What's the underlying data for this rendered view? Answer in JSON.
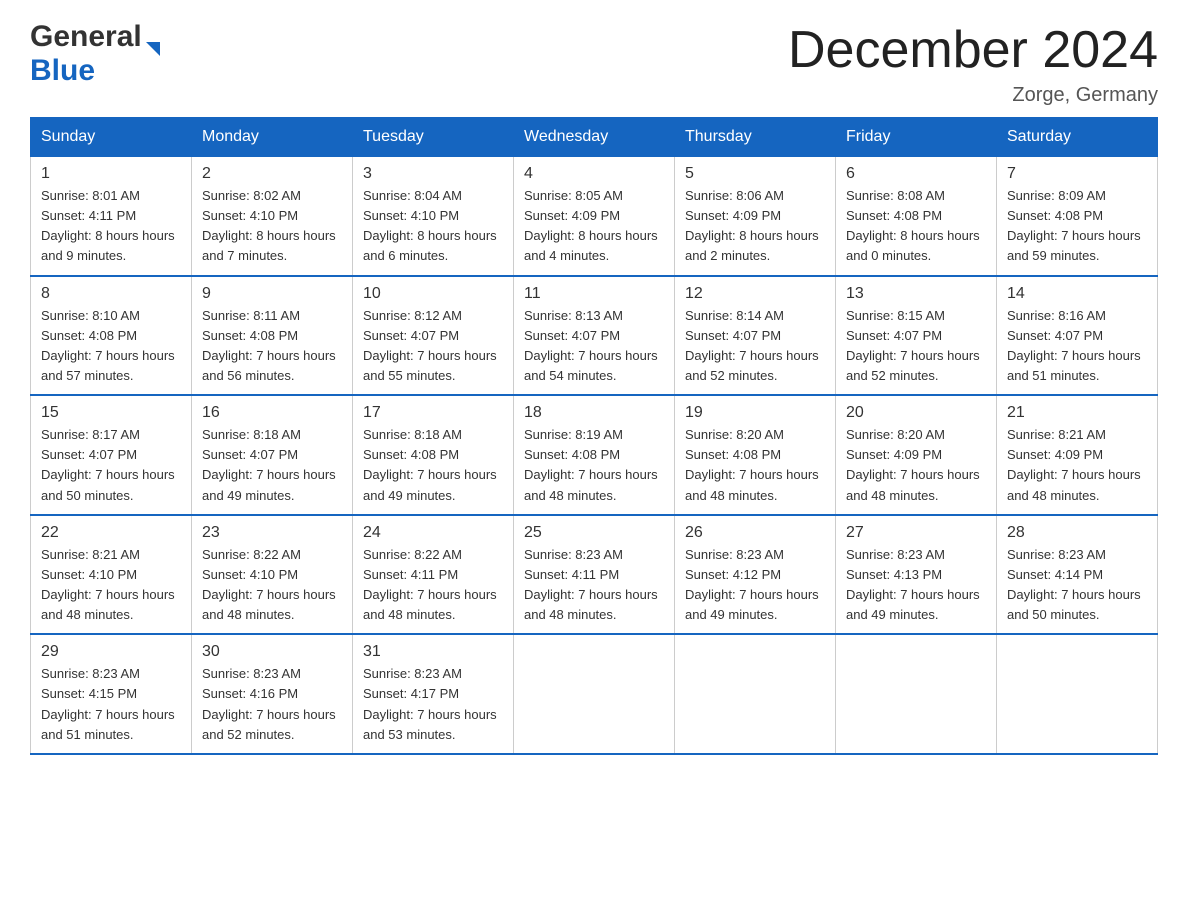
{
  "header": {
    "title": "December 2024",
    "subtitle": "Zorge, Germany",
    "logo_general": "General",
    "logo_blue": "Blue"
  },
  "weekdays": [
    "Sunday",
    "Monday",
    "Tuesday",
    "Wednesday",
    "Thursday",
    "Friday",
    "Saturday"
  ],
  "weeks": [
    [
      {
        "day": "1",
        "sunrise": "8:01 AM",
        "sunset": "4:11 PM",
        "daylight": "8 hours and 9 minutes"
      },
      {
        "day": "2",
        "sunrise": "8:02 AM",
        "sunset": "4:10 PM",
        "daylight": "8 hours and 7 minutes"
      },
      {
        "day": "3",
        "sunrise": "8:04 AM",
        "sunset": "4:10 PM",
        "daylight": "8 hours and 6 minutes"
      },
      {
        "day": "4",
        "sunrise": "8:05 AM",
        "sunset": "4:09 PM",
        "daylight": "8 hours and 4 minutes"
      },
      {
        "day": "5",
        "sunrise": "8:06 AM",
        "sunset": "4:09 PM",
        "daylight": "8 hours and 2 minutes"
      },
      {
        "day": "6",
        "sunrise": "8:08 AM",
        "sunset": "4:08 PM",
        "daylight": "8 hours and 0 minutes"
      },
      {
        "day": "7",
        "sunrise": "8:09 AM",
        "sunset": "4:08 PM",
        "daylight": "7 hours and 59 minutes"
      }
    ],
    [
      {
        "day": "8",
        "sunrise": "8:10 AM",
        "sunset": "4:08 PM",
        "daylight": "7 hours and 57 minutes"
      },
      {
        "day": "9",
        "sunrise": "8:11 AM",
        "sunset": "4:08 PM",
        "daylight": "7 hours and 56 minutes"
      },
      {
        "day": "10",
        "sunrise": "8:12 AM",
        "sunset": "4:07 PM",
        "daylight": "7 hours and 55 minutes"
      },
      {
        "day": "11",
        "sunrise": "8:13 AM",
        "sunset": "4:07 PM",
        "daylight": "7 hours and 54 minutes"
      },
      {
        "day": "12",
        "sunrise": "8:14 AM",
        "sunset": "4:07 PM",
        "daylight": "7 hours and 52 minutes"
      },
      {
        "day": "13",
        "sunrise": "8:15 AM",
        "sunset": "4:07 PM",
        "daylight": "7 hours and 52 minutes"
      },
      {
        "day": "14",
        "sunrise": "8:16 AM",
        "sunset": "4:07 PM",
        "daylight": "7 hours and 51 minutes"
      }
    ],
    [
      {
        "day": "15",
        "sunrise": "8:17 AM",
        "sunset": "4:07 PM",
        "daylight": "7 hours and 50 minutes"
      },
      {
        "day": "16",
        "sunrise": "8:18 AM",
        "sunset": "4:07 PM",
        "daylight": "7 hours and 49 minutes"
      },
      {
        "day": "17",
        "sunrise": "8:18 AM",
        "sunset": "4:08 PM",
        "daylight": "7 hours and 49 minutes"
      },
      {
        "day": "18",
        "sunrise": "8:19 AM",
        "sunset": "4:08 PM",
        "daylight": "7 hours and 48 minutes"
      },
      {
        "day": "19",
        "sunrise": "8:20 AM",
        "sunset": "4:08 PM",
        "daylight": "7 hours and 48 minutes"
      },
      {
        "day": "20",
        "sunrise": "8:20 AM",
        "sunset": "4:09 PM",
        "daylight": "7 hours and 48 minutes"
      },
      {
        "day": "21",
        "sunrise": "8:21 AM",
        "sunset": "4:09 PM",
        "daylight": "7 hours and 48 minutes"
      }
    ],
    [
      {
        "day": "22",
        "sunrise": "8:21 AM",
        "sunset": "4:10 PM",
        "daylight": "7 hours and 48 minutes"
      },
      {
        "day": "23",
        "sunrise": "8:22 AM",
        "sunset": "4:10 PM",
        "daylight": "7 hours and 48 minutes"
      },
      {
        "day": "24",
        "sunrise": "8:22 AM",
        "sunset": "4:11 PM",
        "daylight": "7 hours and 48 minutes"
      },
      {
        "day": "25",
        "sunrise": "8:23 AM",
        "sunset": "4:11 PM",
        "daylight": "7 hours and 48 minutes"
      },
      {
        "day": "26",
        "sunrise": "8:23 AM",
        "sunset": "4:12 PM",
        "daylight": "7 hours and 49 minutes"
      },
      {
        "day": "27",
        "sunrise": "8:23 AM",
        "sunset": "4:13 PM",
        "daylight": "7 hours and 49 minutes"
      },
      {
        "day": "28",
        "sunrise": "8:23 AM",
        "sunset": "4:14 PM",
        "daylight": "7 hours and 50 minutes"
      }
    ],
    [
      {
        "day": "29",
        "sunrise": "8:23 AM",
        "sunset": "4:15 PM",
        "daylight": "7 hours and 51 minutes"
      },
      {
        "day": "30",
        "sunrise": "8:23 AM",
        "sunset": "4:16 PM",
        "daylight": "7 hours and 52 minutes"
      },
      {
        "day": "31",
        "sunrise": "8:23 AM",
        "sunset": "4:17 PM",
        "daylight": "7 hours and 53 minutes"
      },
      null,
      null,
      null,
      null
    ]
  ],
  "labels": {
    "sunrise": "Sunrise:",
    "sunset": "Sunset:",
    "daylight": "Daylight:"
  }
}
